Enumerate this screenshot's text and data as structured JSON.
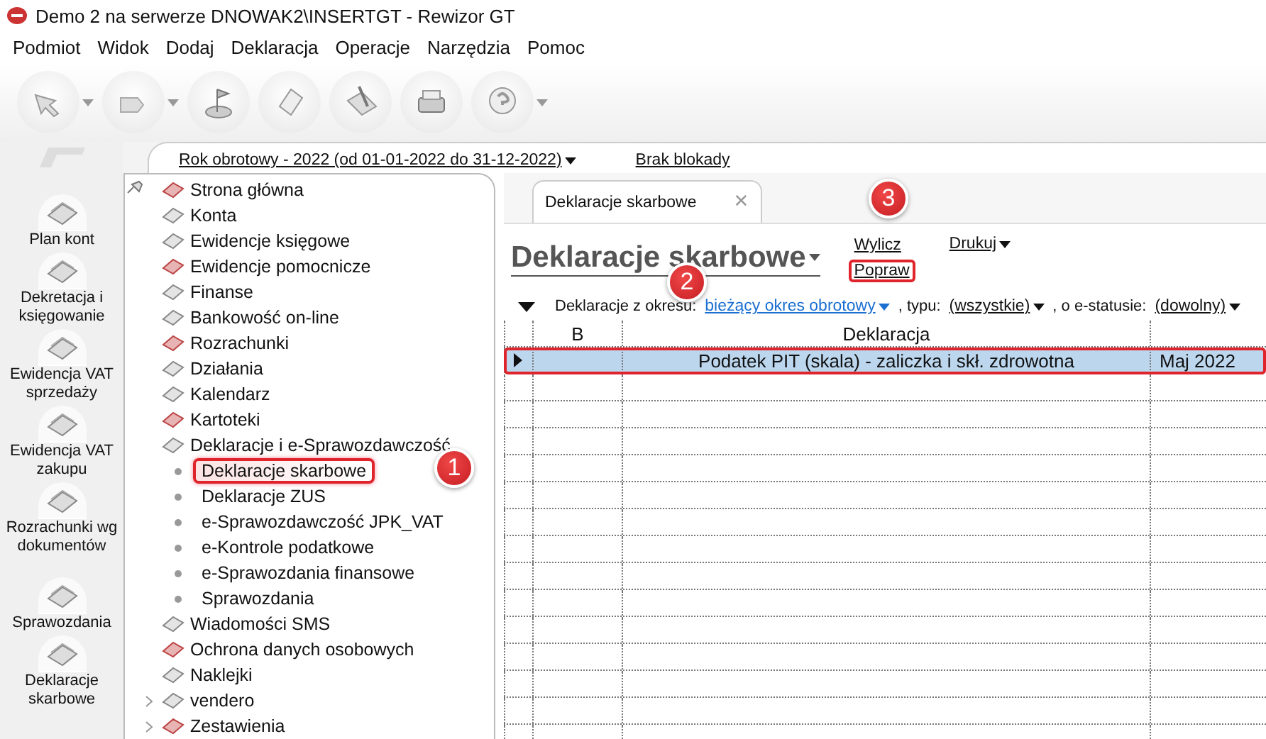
{
  "window": {
    "title": "Demo 2 na serwerze DNOWAK2\\INSERTGT - Rewizor GT"
  },
  "menu": [
    "Podmiot",
    "Widok",
    "Dodaj",
    "Deklaracja",
    "Operacje",
    "Narzędzia",
    "Pomoc"
  ],
  "nav": [
    {
      "label": "Plan kont"
    },
    {
      "label": "Dekretacja i\nksięgowanie"
    },
    {
      "label": "Ewidencja VAT\nsprzedaży"
    },
    {
      "label": "Ewidencja VAT\nzakupu"
    },
    {
      "label": "Rozrachunki wg\ndokumentów"
    },
    {
      "label": "Sprawozdania"
    },
    {
      "label": "Deklaracje\nskarbowe"
    }
  ],
  "period": {
    "label": "Rok obrotowy - 2022  (od 01-01-2022 do 31-12-2022)",
    "dropdown": true
  },
  "lock": "Brak blokady",
  "tree": [
    {
      "label": "Strona główna",
      "collapsed": false
    },
    {
      "label": "Konta",
      "collapsed": false
    },
    {
      "label": "Ewidencje księgowe",
      "collapsed": false
    },
    {
      "label": "Ewidencje pomocnicze",
      "collapsed": false
    },
    {
      "label": "Finanse",
      "collapsed": false
    },
    {
      "label": "Bankowość on-line",
      "collapsed": false
    },
    {
      "label": "Rozrachunki",
      "collapsed": false
    },
    {
      "label": "Działania",
      "collapsed": false
    },
    {
      "label": "Kalendarz",
      "collapsed": false
    },
    {
      "label": "Kartoteki",
      "collapsed": false
    },
    {
      "label": "Deklaracje i e-Sprawozdawczość",
      "collapsed": false,
      "children": [
        {
          "label": "Deklaracje skarbowe",
          "selected": true,
          "highlighted": true
        },
        {
          "label": "Deklaracje ZUS",
          "selected": false,
          "highlighted": false
        },
        {
          "label": "e-Sprawozdawczość JPK_VAT",
          "selected": false,
          "highlighted": false
        },
        {
          "label": "e-Kontrole podatkowe",
          "selected": false,
          "highlighted": false
        },
        {
          "label": "e-Sprawozdania finansowe",
          "selected": false,
          "highlighted": false
        },
        {
          "label": "Sprawozdania",
          "selected": false,
          "highlighted": false
        }
      ]
    },
    {
      "label": "Wiadomości SMS",
      "collapsed": false
    },
    {
      "label": "Ochrona danych osobowych",
      "collapsed": false
    },
    {
      "label": "Naklejki",
      "collapsed": false
    },
    {
      "label": "vendero",
      "collapsed": true
    },
    {
      "label": "Zestawienia",
      "collapsed": true
    }
  ],
  "tabs": [
    {
      "label": "Deklaracje skarbowe",
      "selected": true,
      "close": "✕"
    }
  ],
  "heading": "Deklaracje skarbowe",
  "actions": [
    {
      "label": "Wylicz",
      "dropdown": false,
      "highlighted": false
    },
    {
      "label": "Popraw",
      "dropdown": false,
      "highlighted": true
    },
    {
      "label": "Drukuj",
      "dropdown": true,
      "highlighted": false
    }
  ],
  "filter": {
    "label": "Deklaracje z okresu:",
    "period": "bieżący okres obrotowy",
    "type_label": ", typu:",
    "type": "(wszystkie)",
    "status_label": ", o e-statusie:",
    "status": "(dowolny)"
  },
  "table": {
    "columns": [
      "B",
      "Deklaracja"
    ],
    "rows": [
      {
        "declaration": "Podatek PIT (skala) - zaliczka i skł. zdrowotna",
        "column_4": "Maj 2022",
        "selected": true,
        "highlighted": true
      }
    ]
  },
  "callouts": [
    "1",
    "2",
    "3"
  ]
}
